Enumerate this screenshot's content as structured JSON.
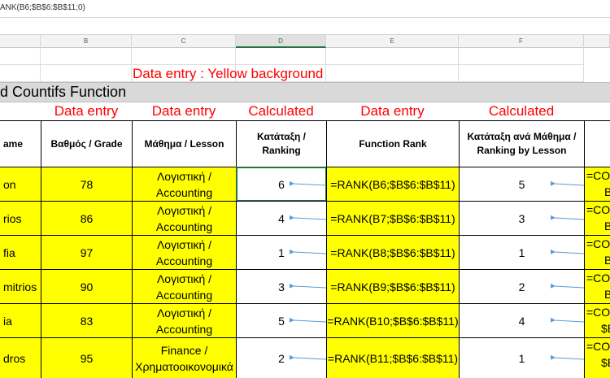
{
  "formula_bar": {
    "text": "ANK(B6;$B$6:$B$11;0)"
  },
  "columns": [
    "B",
    "C",
    "D",
    "E",
    "F"
  ],
  "notes": {
    "yellow": "Data entry : Yellow background"
  },
  "title": "d Countifs Function",
  "categories": [
    "Data entry",
    "Data entry",
    "Calculated",
    "Data entry",
    "Calculated"
  ],
  "headers": {
    "name": "ame",
    "grade": "Βαθμός / Grade",
    "lesson": "Μάθημα / Lesson",
    "ranking": "Κατάταξη / Ranking",
    "function_rank": "Function Rank",
    "ranking_by_lesson": "Κατάταξη ανά Μάθημα / Ranking by Lesson"
  },
  "rows": [
    {
      "name": "on",
      "grade": "78",
      "lesson": "Λογιστική / Accounting",
      "rank": "6",
      "formula": "=RANK(B6;$B$6:$B$11)",
      "rank_by_lesson": "5",
      "countifs": "=COU",
      "countifs2": "B"
    },
    {
      "name": "rios",
      "grade": "86",
      "lesson": "Λογιστική / Accounting",
      "rank": "4",
      "formula": "=RANK(B7;$B$6:$B$11)",
      "rank_by_lesson": "3",
      "countifs": "=COU",
      "countifs2": "B"
    },
    {
      "name": "fia",
      "grade": "97",
      "lesson": "Λογιστική / Accounting",
      "rank": "1",
      "formula": "=RANK(B8;$B$6:$B$11)",
      "rank_by_lesson": "1",
      "countifs": "=COU",
      "countifs2": "B"
    },
    {
      "name": "mitrios",
      "grade": "90",
      "lesson": "Λογιστική / Accounting",
      "rank": "3",
      "formula": "=RANK(B9;$B$6:$B$11)",
      "rank_by_lesson": "2",
      "countifs": "=COU",
      "countifs2": "B"
    },
    {
      "name": "ia",
      "grade": "83",
      "lesson": "Λογιστική / Accounting",
      "rank": "5",
      "formula": "=RANK(B10;$B$6:$B$11)",
      "rank_by_lesson": "4",
      "countifs": "=COU",
      "countifs2": "$B"
    },
    {
      "name": "dros",
      "grade": "95",
      "lesson": "Finance / Χρηματοοικονομικά",
      "rank": "2",
      "formula": "=RANK(B11;$B$6:$B$11)",
      "rank_by_lesson": "1",
      "countifs": "=COU",
      "countifs2": "$B"
    }
  ],
  "colors": {
    "yellow": "#ffff00",
    "red": "#ff0000",
    "arrow": "#5b9bd5",
    "excel_green": "#217346"
  }
}
